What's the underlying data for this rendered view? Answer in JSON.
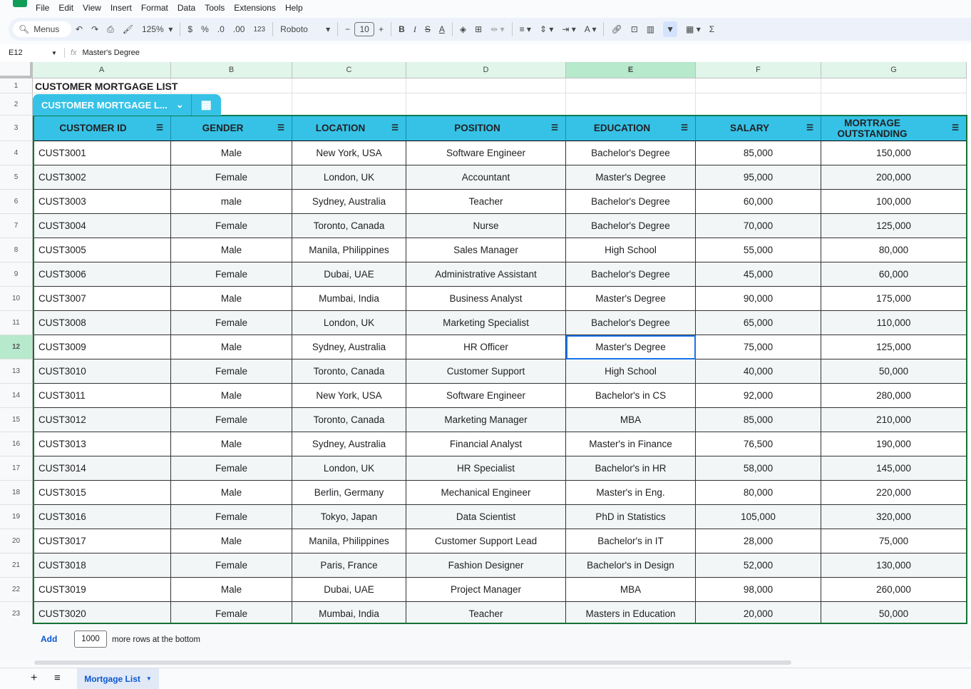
{
  "menus": [
    "File",
    "Edit",
    "View",
    "Insert",
    "Format",
    "Data",
    "Tools",
    "Extensions",
    "Help"
  ],
  "toolbar": {
    "search": "Menus",
    "zoom": "125%",
    "currency": "$",
    "percent": "%",
    "dec_decrease": ".0",
    "dec_increase": ".00",
    "format_123": "123",
    "font": "Roboto",
    "font_size": "10",
    "bold": "B",
    "italic": "I",
    "sum": "Σ"
  },
  "formula_bar": {
    "cell_ref": "E12",
    "fx": "fx",
    "value": "Master's Degree"
  },
  "columns": [
    "A",
    "B",
    "C",
    "D",
    "E",
    "F",
    "G"
  ],
  "title": "CUSTOMER MORTGAGE LIST",
  "table_chip": "CUSTOMER MORTGAGE L...",
  "headers": [
    "CUSTOMER ID",
    "GENDER",
    "LOCATION",
    "POSITION",
    "EDUCATION",
    "SALARY",
    "MORTRAGE OUTSTANDING"
  ],
  "rows": [
    [
      "CUST3001",
      "Male",
      "New York, USA",
      "Software Engineer",
      "Bachelor's Degree",
      "85,000",
      "150,000"
    ],
    [
      "CUST3002",
      "Female",
      "London, UK",
      "Accountant",
      "Master's Degree",
      "95,000",
      "200,000"
    ],
    [
      "CUST3003",
      "male",
      "Sydney, Australia",
      "Teacher",
      "Bachelor's Degree",
      "60,000",
      "100,000"
    ],
    [
      "CUST3004",
      "Female",
      "Toronto, Canada",
      "Nurse",
      "Bachelor's Degree",
      "70,000",
      "125,000"
    ],
    [
      "CUST3005",
      "Male",
      "Manila, Philippines",
      "Sales Manager",
      "High School",
      "55,000",
      "80,000"
    ],
    [
      "CUST3006",
      "Female",
      "Dubai, UAE",
      "Administrative Assistant",
      "Bachelor's Degree",
      "45,000",
      "60,000"
    ],
    [
      "CUST3007",
      "Male",
      "Mumbai, India",
      "Business Analyst",
      "Master's Degree",
      "90,000",
      "175,000"
    ],
    [
      "CUST3008",
      "Female",
      "London, UK",
      "Marketing Specialist",
      "Bachelor's Degree",
      "65,000",
      "110,000"
    ],
    [
      "CUST3009",
      "Male",
      "Sydney, Australia",
      "HR Officer",
      "Master's Degree",
      "75,000",
      "125,000"
    ],
    [
      "CUST3010",
      "Female",
      "Toronto, Canada",
      "Customer Support",
      "High School",
      "40,000",
      "50,000"
    ],
    [
      "CUST3011",
      "Male",
      "New York, USA",
      "Software Engineer",
      "Bachelor's in CS",
      "92,000",
      "280,000"
    ],
    [
      "CUST3012",
      "Female",
      "Toronto, Canada",
      "Marketing Manager",
      "MBA",
      "85,000",
      "210,000"
    ],
    [
      "CUST3013",
      "Male",
      "Sydney, Australia",
      "Financial Analyst",
      "Master's in Finance",
      "76,500",
      "190,000"
    ],
    [
      "CUST3014",
      "Female",
      "London, UK",
      "HR Specialist",
      "Bachelor's in HR",
      "58,000",
      "145,000"
    ],
    [
      "CUST3015",
      "Male",
      "Berlin, Germany",
      "Mechanical Engineer",
      "Master's in Eng.",
      "80,000",
      "220,000"
    ],
    [
      "CUST3016",
      "Female",
      "Tokyo, Japan",
      "Data Scientist",
      "PhD in Statistics",
      "105,000",
      "320,000"
    ],
    [
      "CUST3017",
      "Male",
      "Manila, Philippines",
      "Customer Support Lead",
      "Bachelor's in IT",
      "28,000",
      "75,000"
    ],
    [
      "CUST3018",
      "Female",
      "Paris, France",
      "Fashion Designer",
      "Bachelor's in Design",
      "52,000",
      "130,000"
    ],
    [
      "CUST3019",
      "Male",
      "Dubai, UAE",
      "Project Manager",
      "MBA",
      "98,000",
      "260,000"
    ],
    [
      "CUST3020",
      "Female",
      "Mumbai, India",
      "Teacher",
      "Masters in Education",
      "20,000",
      "50,000"
    ]
  ],
  "row_numbers": [
    "1",
    "2",
    "3",
    "4",
    "5",
    "6",
    "7",
    "8",
    "9",
    "10",
    "11",
    "12",
    "13",
    "14",
    "15",
    "16",
    "17",
    "18",
    "19",
    "20",
    "21",
    "22",
    "23"
  ],
  "add_rows": {
    "button": "Add",
    "count": "1000",
    "label": "more rows at the bottom"
  },
  "sheet_tab": "Mortgage List",
  "colors": {
    "header": "#36c2e6",
    "band": "#f3f6f7",
    "accent": "#0b57d0"
  }
}
